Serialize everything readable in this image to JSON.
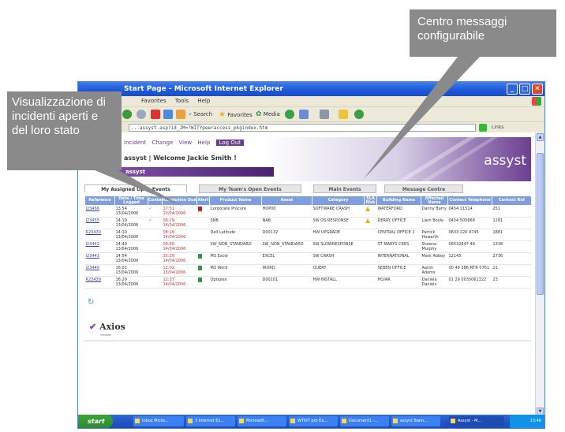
{
  "window": {
    "title": "Start Page - Microsoft Internet Explorer",
    "minimize": "_",
    "maximize": "□",
    "close": "✕"
  },
  "menu": [
    "Favorites",
    "Tools",
    "Help"
  ],
  "toolbar": {
    "search": "Search",
    "favorites": "Favorites",
    "media": "Media"
  },
  "address": {
    "value": "...assyst.asp?id_JM=?WITYpeeraccess_pkgindex.htm",
    "go": "Go",
    "links": "Links"
  },
  "banner": {
    "menu": [
      "Incident",
      "Change",
      "View",
      "Help"
    ],
    "logout": "Log Out",
    "welcome": "assyst | Welcome Jackie Smith !",
    "band": "assyst",
    "logo": "assyst"
  },
  "tabs": [
    "My Assigned Open Events",
    "My Team's Open Events",
    "Main Events",
    "Message Centre"
  ],
  "table": {
    "headers": [
      "Reference",
      "Date / Time Logged",
      "Contact",
      "Resolution Due",
      "Alert",
      "Product Name",
      "Asset",
      "Category",
      "SLA Risk",
      "Building Name",
      "Affected Name",
      "Contact Telephone",
      "Contact Ref"
    ],
    "rows": [
      {
        "ref": "I23456",
        "logged": "13:54 13/04/2006",
        "contact": "✓",
        "due": "17:51 13/04/2006",
        "alert": "red",
        "product": "Corporate Procure",
        "asset": "HOP00",
        "category": "SOFTWARE CRASH",
        "risk": "warn",
        "building": "WATERFORD",
        "affected": "Danny Barry",
        "phone": "0454 21514",
        "cref": "251"
      },
      {
        "ref": "I23455",
        "logged": "14:19 13/04/2006",
        "contact": "✓",
        "due": "06:29 14/04/2006",
        "alert": "",
        "product": "SNB",
        "asset": "NAB",
        "category": "SW OS RESPONSE",
        "risk": "warn",
        "building": "DERRY OFFICE",
        "affected": "Liam Boyle",
        "phone": "0454 505668",
        "cref": "1281"
      },
      {
        "ref": "R23430",
        "logged": "14:10 13/04/2006",
        "contact": "",
        "due": "08:19 14/04/2006",
        "alert": "",
        "product": "Dell Latitude",
        "asset": "D00132",
        "category": "HW UPGRADE",
        "risk": "",
        "building": "CENTRAL OFFICE 1",
        "affected": "Patrick Howarth",
        "phone": "0633 220 4745",
        "cref": "1881"
      },
      {
        "ref": "I23442",
        "logged": "14:40 13/04/2006",
        "contact": "",
        "due": "09:40 14/04/2006",
        "alert": "",
        "product": "SW_NON_STANDARD",
        "asset": "SW_NON_STANDARD",
        "category": "SW SLOWRESPONSE",
        "risk": "",
        "building": "ST MARYS CRES",
        "affected": "Sheena Murphy",
        "phone": "06532847 46",
        "cref": "1338"
      },
      {
        "ref": "I23441",
        "logged": "14:54 13/04/2006",
        "contact": "",
        "due": "15:29 14/04/2006",
        "alert": "green",
        "product": "MS Excel",
        "asset": "EXCEL",
        "category": "SW CRASH",
        "risk": "",
        "building": "INTERNATIONAL",
        "affected": "Mark Abbey",
        "phone": "12145",
        "cref": "2736"
      },
      {
        "ref": "I23440",
        "logged": "16:01 13/04/2006",
        "contact": "",
        "due": "12:02 13/04/2006",
        "alert": "green",
        "product": "MS Word",
        "asset": "WORD",
        "category": "QUERY",
        "risk": "",
        "building": "SEBEN OFFICE",
        "affected": "Aaron Adams",
        "phone": "00 49 286 NTR 0761",
        "cref": "11"
      },
      {
        "ref": "R23439",
        "logged": "16:29 13/04/2006",
        "contact": "",
        "due": "12:37 14/04/2006",
        "alert": "green",
        "product": "Optiplex",
        "asset": "D00101",
        "category": "HW INSTALL",
        "risk": "",
        "building": "HQ/AR",
        "affected": "Daniela Daniels",
        "phone": "01 29 0035061322",
        "cref": "23"
      }
    ]
  },
  "footer": {
    "logo": "Axios",
    "tagline": "SYSTEMS"
  },
  "taskbar": {
    "start": "start",
    "tasks": [
      "Inbox Micro...",
      "3 Internet Ex...",
      "Microsoft...",
      "WTKIT pro Ex...",
      "Document1 -...",
      "assyst Bann...",
      "Assyst - M..."
    ],
    "tray": "13:46"
  },
  "callouts": {
    "left": "Visualizzazione di incidenti aperti e del loro stato",
    "right": "Centro messaggi configurabile"
  },
  "colors": {
    "callout": "#8a8a8a",
    "assyst_purple": "#6a3d8f",
    "table_header": "#7e9fdb"
  }
}
